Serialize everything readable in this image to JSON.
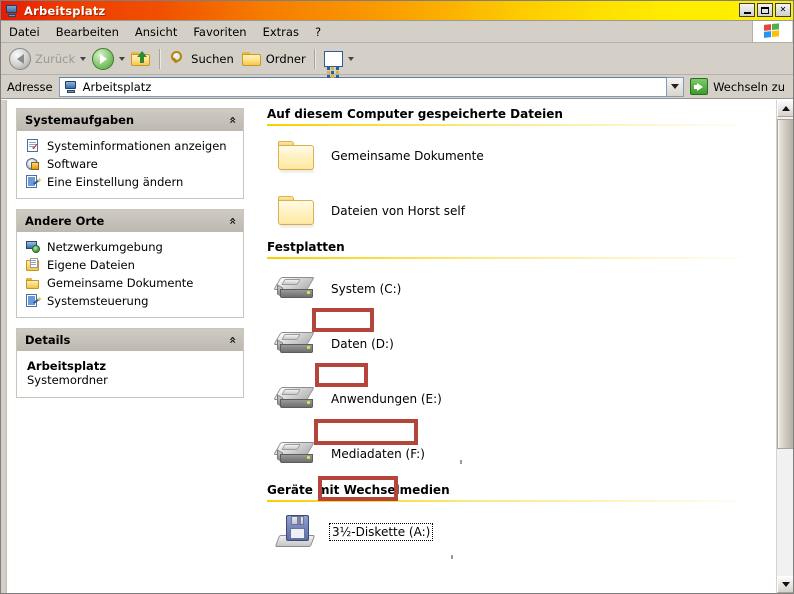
{
  "window": {
    "title": "Arbeitsplatz",
    "title_icon": "computer-icon",
    "minimize_label": "Minimieren",
    "maximize_label": "Maximieren",
    "close_label": "Schließen",
    "close_glyph": "✕"
  },
  "menubar": {
    "items": [
      {
        "label": "Datei"
      },
      {
        "label": "Bearbeiten"
      },
      {
        "label": "Ansicht"
      },
      {
        "label": "Favoriten"
      },
      {
        "label": "Extras"
      },
      {
        "label": "?"
      }
    ],
    "brand_icon": "windows-flag-icon"
  },
  "toolbar": {
    "back_label": "Zurück",
    "back_icon": "arrow-left-icon",
    "forward_icon": "arrow-right-icon",
    "up_label": "Aufwärts",
    "up_icon": "folder-up-icon",
    "search_label": "Suchen",
    "search_icon": "search-icon",
    "folders_label": "Ordner",
    "folders_icon": "folder-icon",
    "views_icon": "views-grid-icon"
  },
  "address": {
    "label": "Adresse",
    "icon": "computer-icon",
    "value": "Arbeitsplatz",
    "placeholder": "Arbeitsplatz",
    "dropdown_icon": "chevron-down-icon",
    "go_label": "Wechseln zu",
    "go_icon": "go-arrow-icon"
  },
  "sidebar": {
    "panels": [
      {
        "title": "Systemaufgaben",
        "collapse_icon": "chevron-up-icon",
        "collapse_glyph": "«",
        "items": [
          {
            "label": "Systeminformationen anzeigen",
            "icon": "system-info-icon"
          },
          {
            "label": "Software",
            "icon": "software-icon"
          },
          {
            "label": "Eine Einstellung ändern",
            "icon": "settings-icon"
          }
        ]
      },
      {
        "title": "Andere Orte",
        "collapse_icon": "chevron-up-icon",
        "collapse_glyph": "«",
        "items": [
          {
            "label": "Netzwerkumgebung",
            "icon": "network-icon"
          },
          {
            "label": "Eigene Dateien",
            "icon": "my-documents-icon"
          },
          {
            "label": "Gemeinsame Dokumente",
            "icon": "shared-folder-icon"
          },
          {
            "label": "Systemsteuerung",
            "icon": "control-panel-icon"
          }
        ]
      }
    ],
    "details": {
      "title": "Details",
      "collapse_icon": "chevron-up-icon",
      "collapse_glyph": "«",
      "name": "Arbeitsplatz",
      "type": "Systemordner"
    }
  },
  "main": {
    "sections": [
      {
        "heading": "Auf diesem Computer gespeicherte Dateien",
        "items": [
          {
            "label": "Gemeinsame Dokumente",
            "icon": "folder-icon",
            "kind": "folder"
          },
          {
            "label": "Dateien von Horst self",
            "icon": "folder-icon",
            "kind": "folder"
          }
        ]
      },
      {
        "heading": "Festplatten",
        "items": [
          {
            "label": "System (C:)",
            "volume": "System",
            "letter": "(C:)",
            "icon": "hard-disk-icon",
            "kind": "drive",
            "highlighted": true
          },
          {
            "label": "Daten (D:)",
            "volume": "Daten",
            "letter": "(D:)",
            "icon": "hard-disk-icon",
            "kind": "drive",
            "highlighted": true
          },
          {
            "label": "Anwendungen (E:)",
            "volume": "Anwendungen",
            "letter": "(E:)",
            "icon": "hard-disk-icon",
            "kind": "drive",
            "highlighted": true
          },
          {
            "label": "Mediadaten (F:)",
            "volume": "Mediadaten",
            "letter": "(F:)",
            "icon": "hard-disk-icon",
            "kind": "drive",
            "highlighted": true
          }
        ]
      },
      {
        "heading": "Geräte mit Wechselmedien",
        "items": [
          {
            "label": "3½-Diskette (A:)",
            "icon": "floppy-disk-icon",
            "kind": "removable",
            "focused": true
          }
        ]
      }
    ]
  },
  "scrollbar": {
    "up_icon": "scroll-up-icon",
    "down_icon": "scroll-down-icon",
    "thumb_label": "vertical-scroll-thumb"
  },
  "colors": {
    "title_start": "#e81b00",
    "title_mid": "#f99400",
    "title_end": "#fff000",
    "annotation": "#b5453b",
    "section_rule": "#f7d000",
    "chrome": "#d4d0c8"
  }
}
